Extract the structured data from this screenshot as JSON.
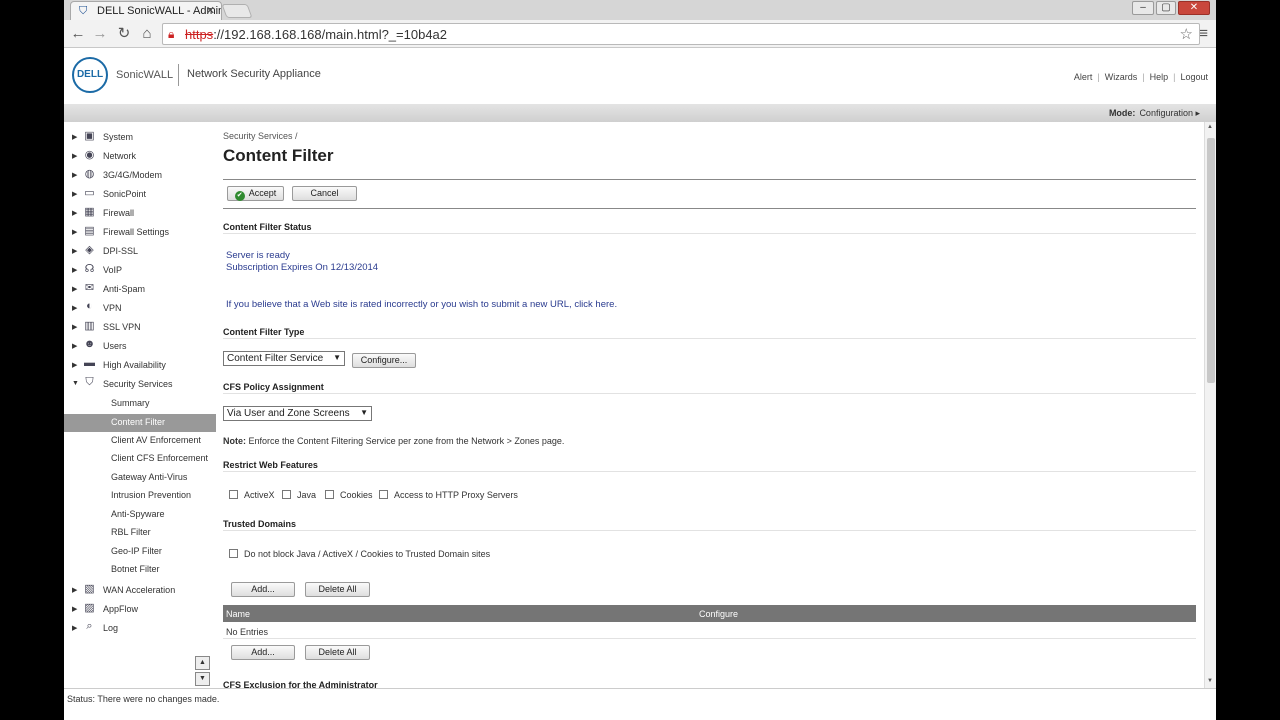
{
  "browser": {
    "tab_title": "DELL SonicWALL - Admin",
    "url_scheme": "https",
    "url_rest": "://192.168.168.168/main.html?_=10b4a2"
  },
  "header": {
    "logo_text": "DELL",
    "brand": "SonicWALL",
    "appliance": "Network Security Appliance",
    "links": [
      "Alert",
      "Wizards",
      "Help",
      "Logout"
    ]
  },
  "modebar": {
    "label": "Mode:",
    "value": "Configuration ▸"
  },
  "sidebar": {
    "items": [
      {
        "label": "System",
        "icon": "system-icon"
      },
      {
        "label": "Network",
        "icon": "network-icon"
      },
      {
        "label": "3G/4G/Modem",
        "icon": "modem-icon"
      },
      {
        "label": "SonicPoint",
        "icon": "sonicpoint-icon"
      },
      {
        "label": "Firewall",
        "icon": "firewall-icon"
      },
      {
        "label": "Firewall Settings",
        "icon": "firewall-settings-icon"
      },
      {
        "label": "DPI-SSL",
        "icon": "dpi-ssl-icon"
      },
      {
        "label": "VoIP",
        "icon": "voip-icon"
      },
      {
        "label": "Anti-Spam",
        "icon": "anti-spam-icon"
      },
      {
        "label": "VPN",
        "icon": "vpn-icon"
      },
      {
        "label": "SSL VPN",
        "icon": "ssl-vpn-icon"
      },
      {
        "label": "Users",
        "icon": "users-icon"
      },
      {
        "label": "High Availability",
        "icon": "high-availability-icon"
      },
      {
        "label": "Security Services",
        "icon": "security-services-icon"
      }
    ],
    "sub_items": [
      "Summary",
      "Content Filter",
      "Client AV Enforcement",
      "Client CFS Enforcement",
      "Gateway Anti-Virus",
      "Intrusion Prevention",
      "Anti-Spyware",
      "RBL Filter",
      "Geo-IP Filter",
      "Botnet Filter"
    ],
    "active_sub": "Content Filter",
    "bottom_items": [
      {
        "label": "WAN Acceleration",
        "icon": "wan-acceleration-icon"
      },
      {
        "label": "AppFlow",
        "icon": "appflow-icon"
      },
      {
        "label": "Log",
        "icon": "log-icon"
      }
    ]
  },
  "status_bar": "Status: There were no changes made.",
  "main": {
    "breadcrumb": "Security Services /",
    "title": "Content Filter",
    "accept_label": "Accept",
    "cancel_label": "Cancel",
    "status_section": {
      "title": "Content Filter Status",
      "server_status": "Server is ready",
      "subscription": "Subscription Expires On 12/13/2014",
      "submit_text": "If you believe that a Web site is rated incorrectly or you wish to submit a new URL, click here."
    },
    "type_section": {
      "title": "Content Filter Type",
      "selected": "Content Filter Service",
      "configure_label": "Configure..."
    },
    "policy_section": {
      "title": "CFS Policy Assignment",
      "selected": "Via User and Zone Screens",
      "note_label": "Note:",
      "note_text": "Enforce the Content Filtering Service per zone from the Network > Zones page."
    },
    "restrict_section": {
      "title": "Restrict Web Features",
      "options": [
        "ActiveX",
        "Java",
        "Cookies",
        "Access to HTTP Proxy Servers"
      ]
    },
    "trusted_section": {
      "title": "Trusted Domains",
      "checkbox_label": "Do not block Java / ActiveX / Cookies to Trusted Domain sites",
      "add_label": "Add...",
      "delete_all_label": "Delete All",
      "columns": [
        "Name",
        "Configure"
      ],
      "empty_text": "No Entries"
    },
    "exclusion_title": "CFS Exclusion for the Administrator"
  }
}
